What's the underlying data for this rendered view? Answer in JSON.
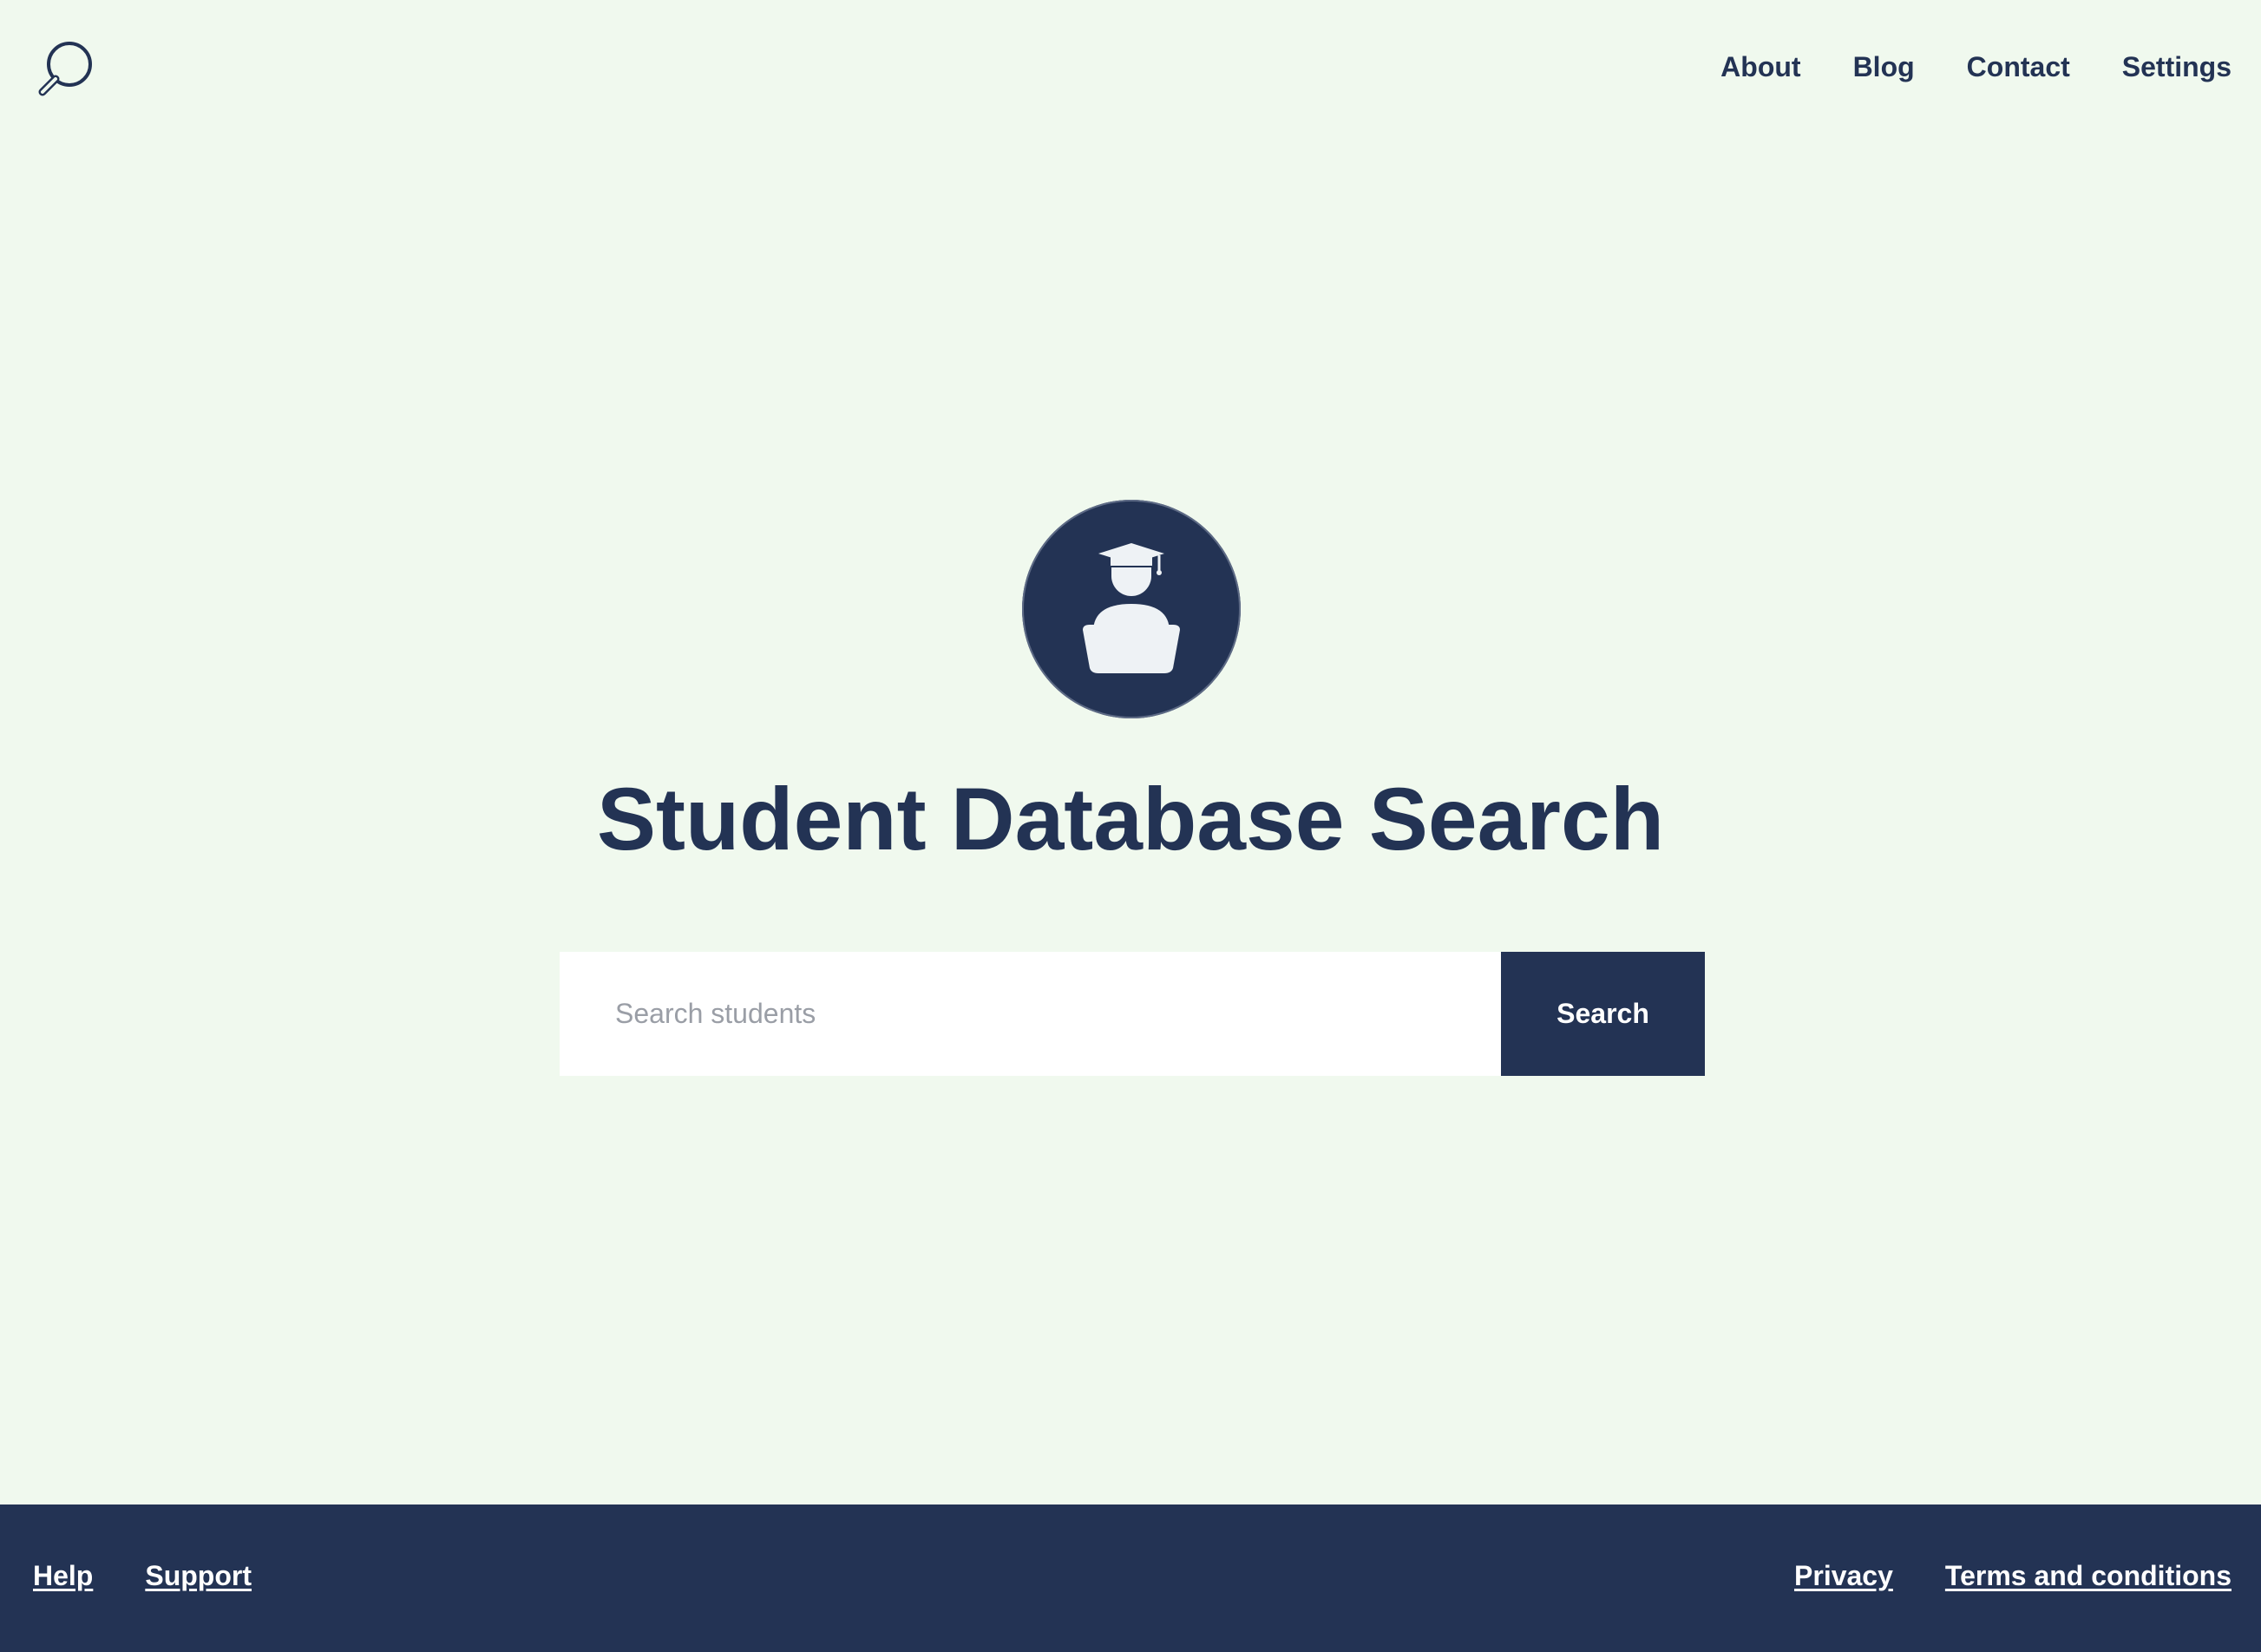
{
  "header": {
    "logo_icon": "search-icon",
    "nav": [
      {
        "label": "About"
      },
      {
        "label": "Blog"
      },
      {
        "label": "Contact"
      },
      {
        "label": "Settings"
      }
    ]
  },
  "hero": {
    "avatar_icon": "graduate-student-icon",
    "title": "Student Database Search",
    "search": {
      "placeholder": "Search students",
      "value": "",
      "button_label": "Search"
    }
  },
  "footer": {
    "left_links": [
      {
        "label": "Help"
      },
      {
        "label": "Support"
      }
    ],
    "right_links": [
      {
        "label": "Privacy"
      },
      {
        "label": "Terms and conditions"
      }
    ]
  },
  "colors": {
    "background": "#f0f9ee",
    "primary": "#233354",
    "input_background": "#ffffff",
    "placeholder": "#9a9ea6"
  }
}
